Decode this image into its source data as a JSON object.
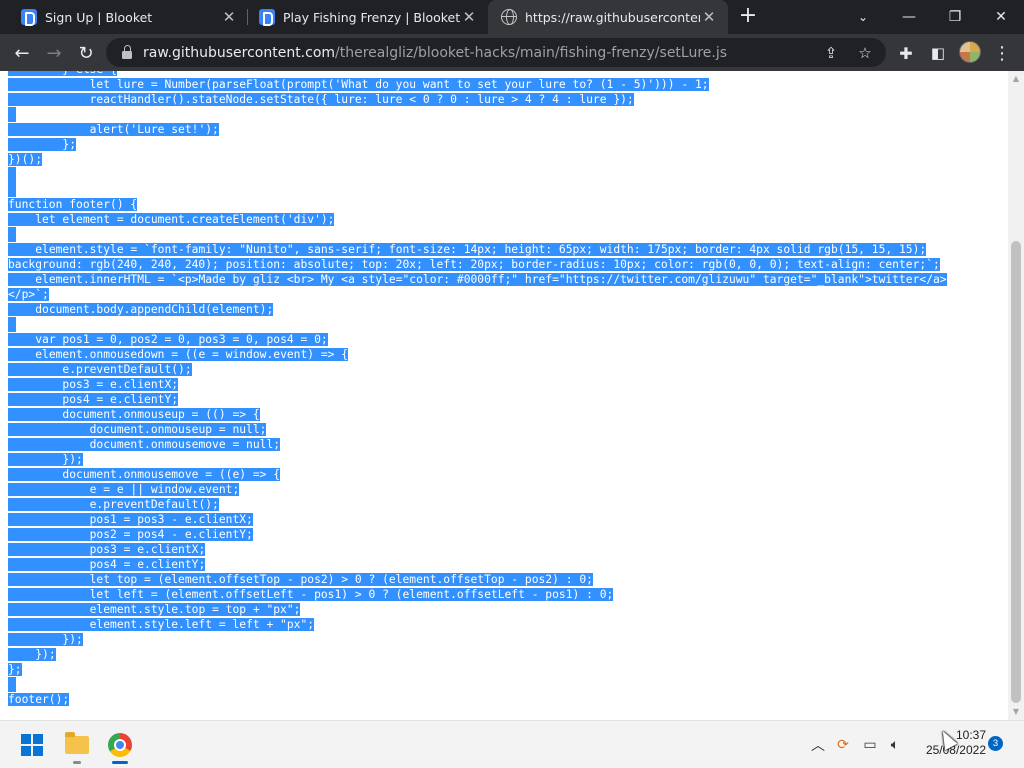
{
  "browser": {
    "tabs": [
      {
        "title": "Sign Up | Blooket",
        "favicon": "blooket-icon",
        "active": false
      },
      {
        "title": "Play Fishing Frenzy | Blooket",
        "favicon": "blooket-icon",
        "active": false
      },
      {
        "title": "https://raw.githubusercontent.com/therealgliz/blooket-hacks/main/fishing-frenzy/setLure.js",
        "favicon": "globe-icon",
        "active": true
      }
    ],
    "new_tab_label": "+",
    "address_bar": {
      "host": "raw.githubusercontent.com",
      "path": "/therealgliz/blooket-hacks/main/fishing-frenzy/setLure.js"
    },
    "colors": {
      "tab_strip": "#202124",
      "toolbar": "#35363a",
      "selection": "#3390ff"
    }
  },
  "code": {
    "lines": [
      "        } else {",
      "            let lure = Number(parseFloat(prompt('What do you want to set your lure to? (1 - 5)'))) - 1;",
      "            reactHandler().stateNode.setState({ lure: lure < 0 ? 0 : lure > 4 ? 4 : lure });",
      "",
      "            alert('Lure set!');",
      "        };",
      "})();",
      "",
      "",
      "function footer() {",
      "    let element = document.createElement('div');",
      "",
      "    element.style = `font-family: \"Nunito\", sans-serif; font-size: 14px; height: 65px; width: 175px; border: 4px solid rgb(15, 15, 15);",
      "background: rgb(240, 240, 240); position: absolute; top: 20x; left: 20px; border-radius: 10px; color: rgb(0, 0, 0); text-align: center;`;",
      "    element.innerHTML = `<p>Made by gliz <br> My <a style=\"color: #0000ff;\" href=\"https://twitter.com/glizuwu\" target=\"_blank\">twitter</a>",
      "</p>`;",
      "    document.body.appendChild(element);",
      "",
      "    var pos1 = 0, pos2 = 0, pos3 = 0, pos4 = 0;",
      "    element.onmousedown = ((e = window.event) => {",
      "        e.preventDefault();",
      "        pos3 = e.clientX;",
      "        pos4 = e.clientY;",
      "        document.onmouseup = (() => {",
      "            document.onmouseup = null;",
      "            document.onmousemove = null;",
      "        });",
      "        document.onmousemove = ((e) => {",
      "            e = e || window.event;",
      "            e.preventDefault();",
      "            pos1 = pos3 - e.clientX;",
      "            pos2 = pos4 - e.clientY;",
      "            pos3 = e.clientX;",
      "            pos4 = e.clientY;",
      "            let top = (element.offsetTop - pos2) > 0 ? (element.offsetTop - pos2) : 0;",
      "            let left = (element.offsetLeft - pos1) > 0 ? (element.offsetLeft - pos1) : 0;",
      "            element.style.top = top + \"px\";",
      "            element.style.left = left + \"px\";",
      "        });",
      "    });",
      "};",
      "",
      "footer();"
    ]
  },
  "taskbar": {
    "pinned": [
      "start-icon",
      "file-explorer-icon",
      "chrome-icon"
    ],
    "tray": [
      "chevron-up-icon",
      "sync-icon",
      "network-icon",
      "volume-icon"
    ],
    "time": "10:37",
    "date": "25/08/2022",
    "notification_count": "3"
  }
}
